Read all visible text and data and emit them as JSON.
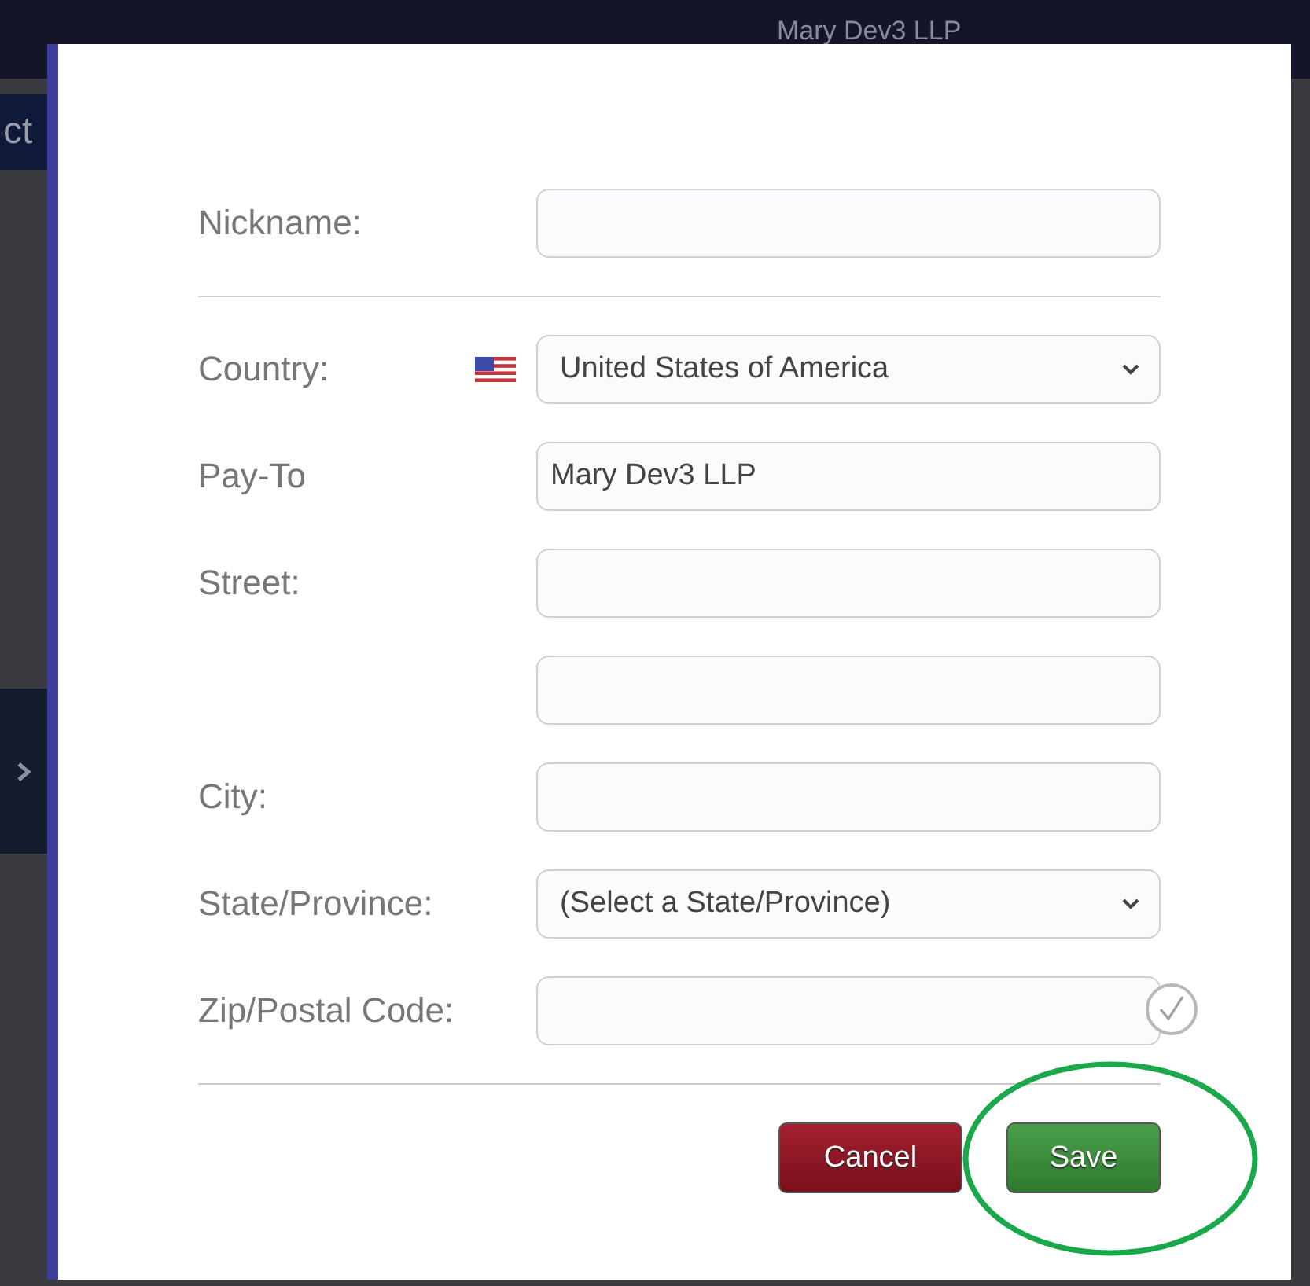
{
  "background": {
    "header_text": "Mary Dev3 LLP",
    "tab_text": "ct"
  },
  "fields": [
    {
      "kind": "text",
      "label": "Nickname:"
    },
    {
      "kind": "divider"
    },
    {
      "kind": "select",
      "label": "Country:",
      "value": "United States of America",
      "flag": true
    },
    {
      "kind": "text",
      "label": "Pay-To",
      "value": "Mary Dev3 LLP"
    },
    {
      "kind": "text",
      "label": "Street:"
    },
    {
      "kind": "text"
    },
    {
      "kind": "text",
      "label": "City:"
    },
    {
      "kind": "select",
      "label": "State/Province:",
      "value": "(Select a State/Province)",
      "flag": false
    },
    {
      "kind": "text",
      "label": "Zip/Postal Code:",
      "valid_mark": true
    },
    {
      "kind": "divider"
    }
  ],
  "buttons": [
    {
      "kind": "cancel",
      "label": "Cancel",
      "highlighted": false
    },
    {
      "kind": "save",
      "label": "Save",
      "highlighted": true
    }
  ]
}
